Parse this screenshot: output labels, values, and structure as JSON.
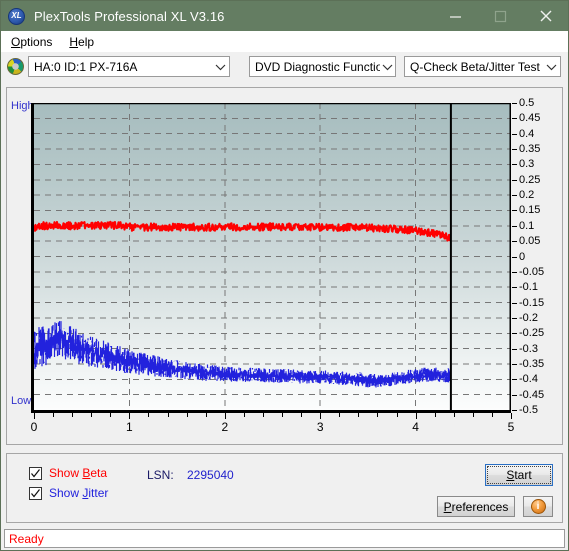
{
  "window": {
    "title": "PlexTools Professional XL V3.16",
    "app_icon": "XL",
    "minimize": "–",
    "maximize": "□",
    "close": "✕"
  },
  "menubar": {
    "items": [
      {
        "label": "Options",
        "accel": "O"
      },
      {
        "label": "Help",
        "accel": "H"
      }
    ]
  },
  "toolbar": {
    "drive_select": "HA:0 ID:1  PX-716A",
    "function_select": "DVD Diagnostic Functions",
    "test_select": "Q-Check Beta/Jitter Test"
  },
  "chart_labels": {
    "high": "High",
    "low": "Low"
  },
  "controls": {
    "show_beta": {
      "label_pre": "Show ",
      "label_accel": "B",
      "label_post": "eta",
      "checked": true
    },
    "show_jitter": {
      "label_pre": "Show ",
      "label_accel": "J",
      "label_post": "itter",
      "checked": true
    },
    "lsn_label": "LSN:",
    "lsn_value": "2295040",
    "start_button": {
      "pre": "",
      "accel": "S",
      "post": "tart"
    },
    "preferences_button": {
      "pre": "",
      "accel": "P",
      "post": "references"
    },
    "info_button": "i"
  },
  "statusbar": {
    "text": "Ready"
  },
  "colors": {
    "titlebar": "#647d62",
    "beta": "#ff0000",
    "jitter": "#2222dd",
    "status": "#ff0000",
    "axis_label": "#3333cc"
  },
  "chart_data": {
    "type": "line",
    "title": "Q-Check Beta/Jitter Test",
    "xlabel": "",
    "ylabel": "",
    "xlim": [
      0,
      5
    ],
    "ylim": [
      -0.5,
      0.5
    ],
    "xticks": [
      0,
      1,
      2,
      3,
      4,
      5
    ],
    "yticks": [
      0.5,
      0.45,
      0.4,
      0.35,
      0.3,
      0.25,
      0.2,
      0.15,
      0.1,
      0.05,
      0,
      -0.05,
      -0.1,
      -0.15,
      -0.2,
      -0.25,
      -0.3,
      -0.35,
      -0.4,
      -0.45,
      -0.5
    ],
    "grid": true,
    "grid_style": "dashed",
    "y_axis_high_label": "High",
    "y_axis_low_label": "Low",
    "data_end_marker_x": 4.37,
    "legend": [
      "Show Beta",
      "Show Jitter"
    ],
    "legend_position": "bottom-left-checkboxes",
    "series": [
      {
        "name": "Beta",
        "color": "#ff0000",
        "noise_amplitude": 0.012,
        "x": [
          0.0,
          0.1,
          0.2,
          0.3,
          0.4,
          0.5,
          0.6,
          0.7,
          0.8,
          0.9,
          1.0,
          1.1,
          1.2,
          1.3,
          1.4,
          1.5,
          1.6,
          1.7,
          1.8,
          1.9,
          2.0,
          2.1,
          2.2,
          2.3,
          2.4,
          2.5,
          2.6,
          2.7,
          2.8,
          2.9,
          3.0,
          3.1,
          3.2,
          3.3,
          3.4,
          3.5,
          3.6,
          3.7,
          3.8,
          3.9,
          4.0,
          4.1,
          4.2,
          4.3,
          4.37
        ],
        "y": [
          0.093,
          0.1,
          0.102,
          0.101,
          0.1,
          0.1,
          0.101,
          0.1,
          0.102,
          0.1,
          0.096,
          0.095,
          0.096,
          0.096,
          0.095,
          0.096,
          0.095,
          0.096,
          0.095,
          0.096,
          0.096,
          0.096,
          0.095,
          0.096,
          0.096,
          0.097,
          0.096,
          0.096,
          0.096,
          0.095,
          0.095,
          0.095,
          0.094,
          0.095,
          0.094,
          0.093,
          0.092,
          0.091,
          0.089,
          0.087,
          0.084,
          0.08,
          0.074,
          0.066,
          0.058
        ]
      },
      {
        "name": "Jitter",
        "color": "#2222dd",
        "note": "Plotted as an inverted band in the lower half of the plot; y values are band centers, band_half is half-width of the noise band.",
        "x": [
          0.0,
          0.05,
          0.1,
          0.15,
          0.2,
          0.25,
          0.3,
          0.35,
          0.4,
          0.45,
          0.5,
          0.6,
          0.7,
          0.8,
          0.9,
          1.0,
          1.1,
          1.2,
          1.3,
          1.4,
          1.5,
          1.6,
          1.7,
          1.8,
          1.9,
          2.0,
          2.2,
          2.4,
          2.6,
          2.8,
          3.0,
          3.2,
          3.4,
          3.5,
          3.6,
          3.7,
          3.8,
          3.9,
          4.0,
          4.1,
          4.2,
          4.3,
          4.37
        ],
        "y": [
          -0.31,
          -0.3,
          -0.292,
          -0.288,
          -0.278,
          -0.272,
          -0.27,
          -0.278,
          -0.285,
          -0.292,
          -0.3,
          -0.31,
          -0.318,
          -0.325,
          -0.334,
          -0.342,
          -0.348,
          -0.353,
          -0.358,
          -0.363,
          -0.368,
          -0.372,
          -0.375,
          -0.378,
          -0.38,
          -0.382,
          -0.385,
          -0.387,
          -0.389,
          -0.391,
          -0.392,
          -0.396,
          -0.4,
          -0.403,
          -0.404,
          -0.402,
          -0.398,
          -0.392,
          -0.388,
          -0.386,
          -0.385,
          -0.386,
          -0.387
        ],
        "band_half": [
          0.075,
          0.072,
          0.07,
          0.068,
          0.066,
          0.064,
          0.062,
          0.06,
          0.058,
          0.056,
          0.054,
          0.05,
          0.047,
          0.044,
          0.042,
          0.04,
          0.038,
          0.036,
          0.034,
          0.032,
          0.03,
          0.029,
          0.028,
          0.027,
          0.026,
          0.025,
          0.024,
          0.023,
          0.023,
          0.023,
          0.022,
          0.022,
          0.023,
          0.024,
          0.023,
          0.022,
          0.022,
          0.022,
          0.023,
          0.024,
          0.024,
          0.025,
          0.025
        ]
      }
    ]
  }
}
